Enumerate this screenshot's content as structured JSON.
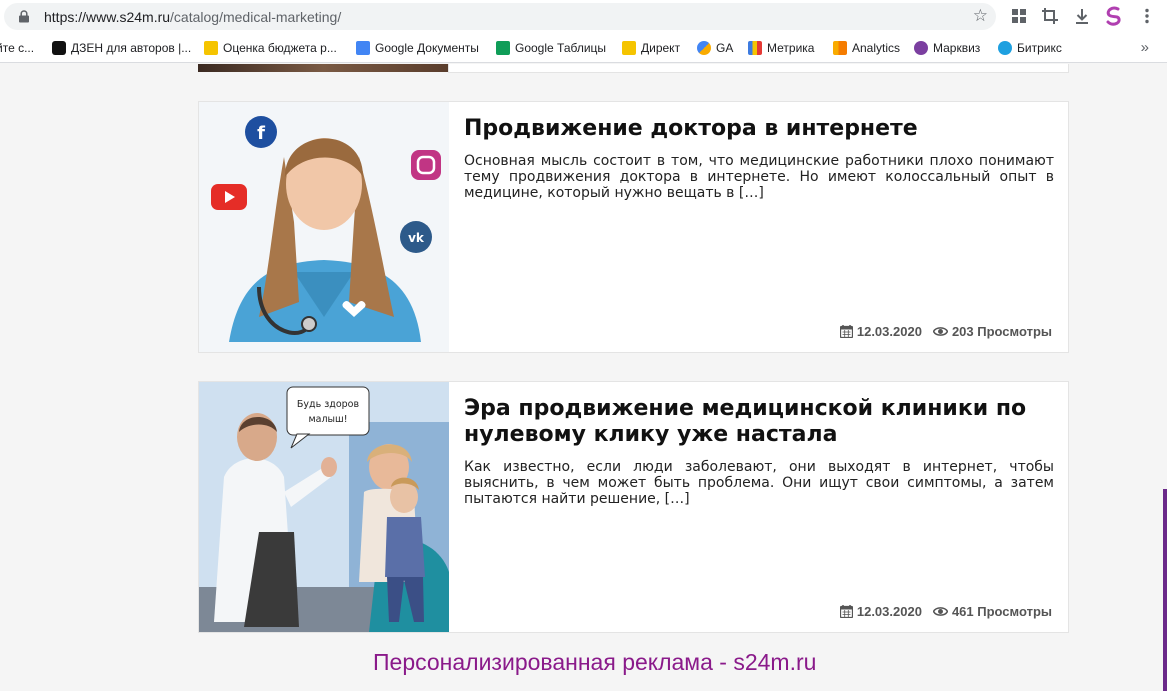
{
  "browser": {
    "url_host": "https://www.s24m.ru",
    "url_path": "/catalog/medical-marketing/",
    "bookmarks": [
      {
        "label": "йте с...",
        "color": "#6b8ec9"
      },
      {
        "label": "ДЗЕН для авторов |...",
        "color": "#111111"
      },
      {
        "label": "Оценка бюджета р...",
        "color": "#f5c400"
      },
      {
        "label": "Google Документы",
        "color": "#4285f4"
      },
      {
        "label": "Google Таблицы",
        "color": "#0f9d58"
      },
      {
        "label": "Директ",
        "color": "#f5c400"
      },
      {
        "label": "GA",
        "color": "#f9ab00"
      },
      {
        "label": "Метрика",
        "color": "#e53935"
      },
      {
        "label": "Analytics",
        "color": "#f57c00"
      },
      {
        "label": "Марквиз",
        "color": "#7b3fa0"
      },
      {
        "label": "Битрикс",
        "color": "#1ea0e0"
      }
    ],
    "more_label": "»"
  },
  "articles": [
    {
      "title": "Продвижение доктора в интернете",
      "excerpt": "Основная мысль состоит в том, что медицинские работники плохо понимают тему продвижения доктора в интернете. Но имеют колоссальный опыт в медицине, который нужно вещать в […]",
      "date": "12.03.2020",
      "views": "203 Просмотры"
    },
    {
      "title": "Эра продвижение медицинской клиники по нулевому клику уже настала",
      "excerpt": "Как известно, если люди заболевают, они выходят в интернет, чтобы выяснить, в чем может быть проблема. Они ищут свои симптомы, а затем пытаются найти решение, […]",
      "date": "12.03.2020",
      "views": "461 Просмотры",
      "bubble_line1": "Будь здоров",
      "bubble_line2": "малыш!"
    }
  ],
  "caption": "Персонализированная реклама - s24m.ru",
  "colors": {
    "caption": "#8a1a8a",
    "accent_purple": "#6b2a8a"
  }
}
